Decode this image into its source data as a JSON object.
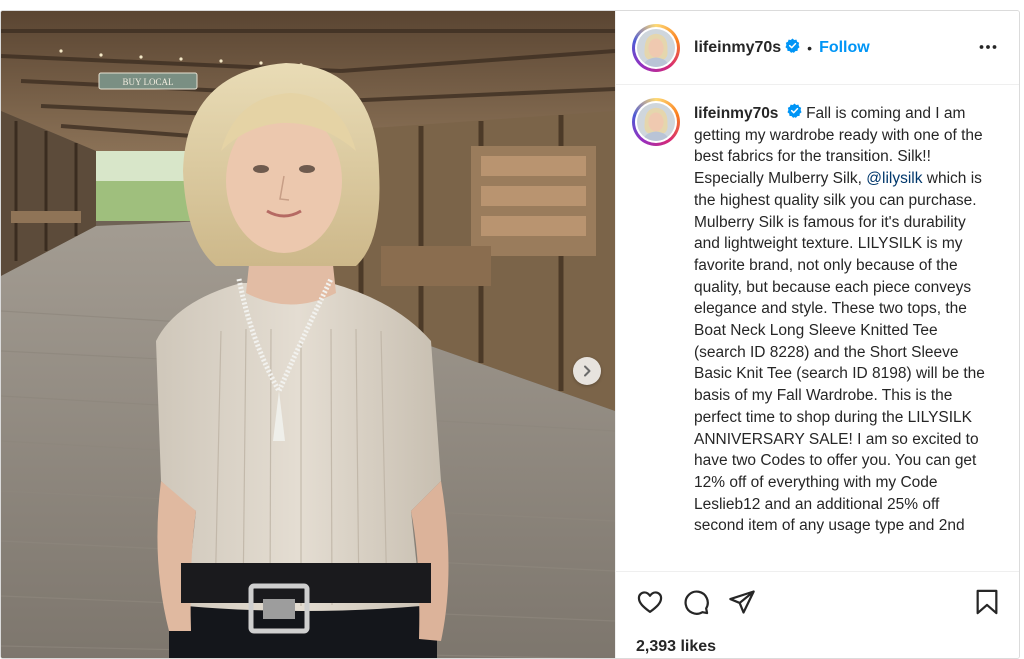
{
  "post": {
    "author": {
      "username": "lifeinmy70s",
      "verified": true,
      "separator": "•",
      "follow_label": "Follow"
    },
    "caption": {
      "username": "lifeinmy70s",
      "text_before_mention": "Fall is coming and I am getting my wardrobe ready with one of the best fabrics for the transition. Silk!! Especially Mulberry Silk, ",
      "mention": "@lilysilk",
      "text_after_mention": " which is the highest quality silk you can purchase. Mulberry Silk is famous for it's durability and lightweight texture. LILYSILK is my favorite brand, not only because of the quality, but because each piece conveys elegance and style. These two tops, the Boat Neck Long Sleeve Knitted Tee (search ID 8228) and the Short Sleeve Basic Knit Tee (search ID 8198) will be the basis of my Fall Wardrobe. This is the perfect time to shop during the LILYSILK ANNIVERSARY SALE! I am so excited to have two Codes to offer you. You can get 12% off of everything with my Code Leslieb12 and an additional 25% off second item of any usage type and 2nd"
    },
    "photo": {
      "sign_text": "BUY LOCAL",
      "description_icon": "carousel-photo"
    },
    "likes_text": "2,393 likes",
    "icons": {
      "more": "more-options-icon",
      "like": "heart-icon",
      "comment": "comment-icon",
      "share": "share-icon",
      "save": "bookmark-icon",
      "next": "chevron-right-icon"
    },
    "colors": {
      "link": "#0095f6",
      "mention": "#00376b",
      "verified": "#0095f6"
    }
  }
}
